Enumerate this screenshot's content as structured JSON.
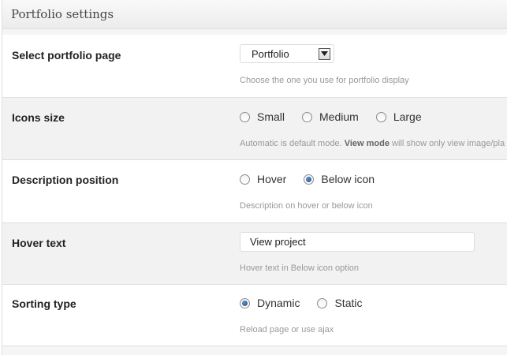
{
  "panel": {
    "title": "Portfolio settings"
  },
  "rows": {
    "portfolio_page": {
      "label": "Select portfolio page",
      "select_value": "Portfolio",
      "description": "Choose the one you use for portfolio display"
    },
    "icons_size": {
      "label": "Icons size",
      "options": [
        "Small",
        "Medium",
        "Large"
      ],
      "selected": null,
      "description_pre": "Automatic is default mode. ",
      "description_bold": "View mode",
      "description_post": " will show only view image/pla"
    },
    "description_position": {
      "label": "Description position",
      "options": [
        "Hover",
        "Below icon"
      ],
      "selected": "Below icon",
      "description": "Description on hover or below icon"
    },
    "hover_text": {
      "label": "Hover text",
      "input_value": "View project",
      "description": "Hover text in Below icon option"
    },
    "sorting_type": {
      "label": "Sorting type",
      "options": [
        "Dynamic",
        "Static"
      ],
      "selected": "Dynamic",
      "description": "Reload page or use ajax"
    }
  }
}
